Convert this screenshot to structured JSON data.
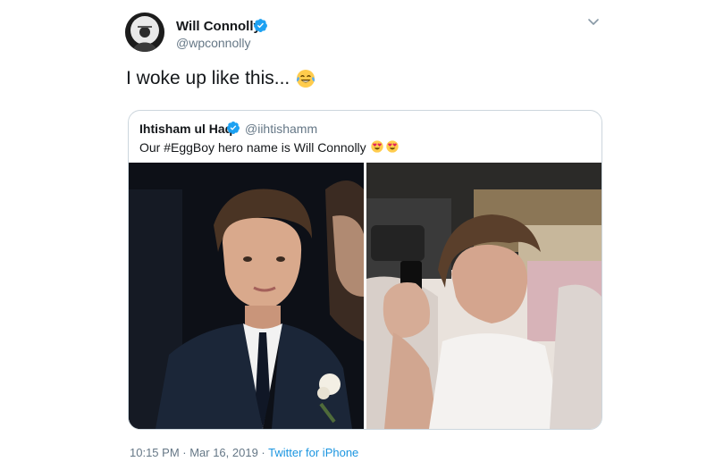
{
  "tweet": {
    "author": {
      "name": "Will Connolly",
      "handle": "@wpconnolly"
    },
    "text": "I woke up like this...",
    "text_emoji": "face-with-tears-of-joy",
    "quoted": {
      "author": {
        "name": "Ihtisham ul Haq",
        "handle": "@iihtishamm"
      },
      "text": "Our #EggBoy hero name is Will Connolly",
      "text_emoji": [
        "heart-eyes",
        "heart-eyes"
      ]
    },
    "timestamp": "10:15 PM · Mar 16, 2019 · ",
    "source": "Twitter for iPhone"
  },
  "colors": {
    "verified": "#1da1f2",
    "link": "#1b95e0",
    "muted": "#657786"
  }
}
